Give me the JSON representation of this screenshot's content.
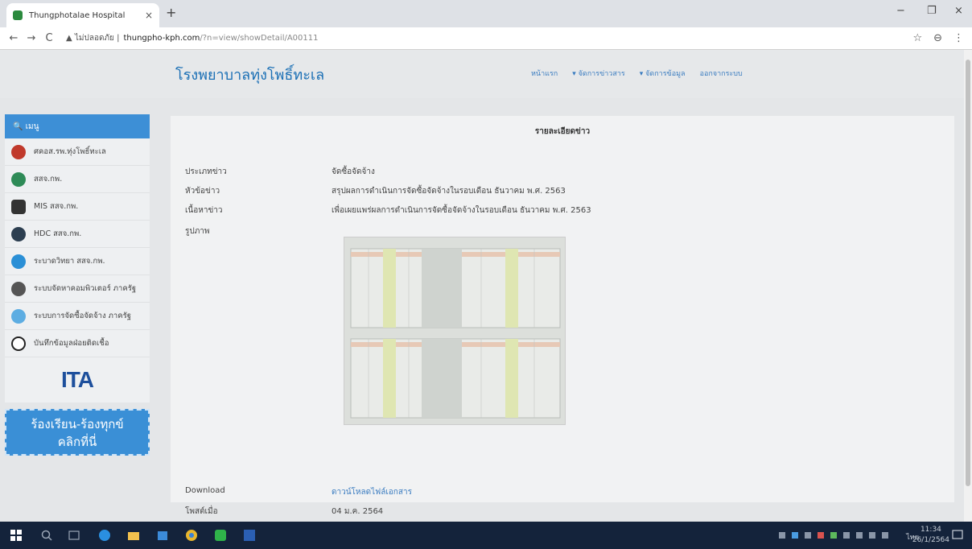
{
  "browser": {
    "tab_title": "Thungphotalae Hospital",
    "tab_close": "×",
    "new_tab": "+",
    "back": "←",
    "forward": "→",
    "reload": "C",
    "security_label": "▲ ไม่ปลอดภัย |",
    "url_host": "thungpho-kph.com",
    "url_path": "/?n=view/showDetail/A00111",
    "star": "☆",
    "profile": "⊖",
    "more": "⋮",
    "minimize": "−",
    "maximize": "❐",
    "close": "×"
  },
  "site": {
    "title": "โรงพยาบาลทุ่งโพธิ์ทะเล",
    "nav": [
      "หน้าแรก",
      "▾ จัดการข่าวสาร",
      "▾ จัดการข้อมูล",
      "ออกจากระบบ"
    ]
  },
  "sidebar": {
    "menu_label": "🔍 เมนู",
    "items": [
      {
        "label": "ศคอส.รพ.ทุ่งโพธิ์ทะเล",
        "color": "#c0392b"
      },
      {
        "label": "สสจ.กพ.",
        "color": "#2e8b57"
      },
      {
        "label": "MIS สสจ.กพ.",
        "color": "#333333"
      },
      {
        "label": "HDC สสจ.กพ.",
        "color": "#2c3e50"
      },
      {
        "label": "ระบาดวิทยา สสจ.กพ.",
        "color": "#2a8fd6"
      },
      {
        "label": "ระบบจัดหาคอมพิวเตอร์ ภาครัฐ",
        "color": "#555555"
      },
      {
        "label": "ระบบการจัดซื้อจัดจ้าง ภาครัฐ",
        "color": "#5dade2"
      },
      {
        "label": "บันทึกข้อมูลฝ่อยติดเชื้อ",
        "color": "#222222"
      }
    ],
    "ita_logo": "ITA",
    "complaint_line1": "ร้องเรียน-ร้องทุกข์",
    "complaint_line2": "คลิกที่นี่"
  },
  "detail": {
    "heading": "รายละเอียดข่าว",
    "type_label": "ประเภทข่าว",
    "type_value": "จัดซื้อจัดจ้าง",
    "topic_label": "หัวข้อข่าว",
    "topic_value": "สรุปผลการดำเนินการจัดซื้อจัดจ้างในรอบเดือน ธันวาคม พ.ศ. 2563",
    "content_label": "เนื้อหาข่าว",
    "content_value": "เพื่อเผยแพร่ผลการดำเนินการจัดซื้อจัดจ้างในรอบเดือน ธันวาคม พ.ศ. 2563",
    "image_label": "รูปภาพ",
    "download_label": "Download",
    "download_link": "ดาวน์โหลดไฟล์เอกสาร",
    "posted_label": "โพสต์เมื่อ",
    "posted_value": "04 ม.ค. 2564"
  },
  "taskbar": {
    "time": "11:34",
    "date": "26/1/2564",
    "lang": "ไทย"
  }
}
